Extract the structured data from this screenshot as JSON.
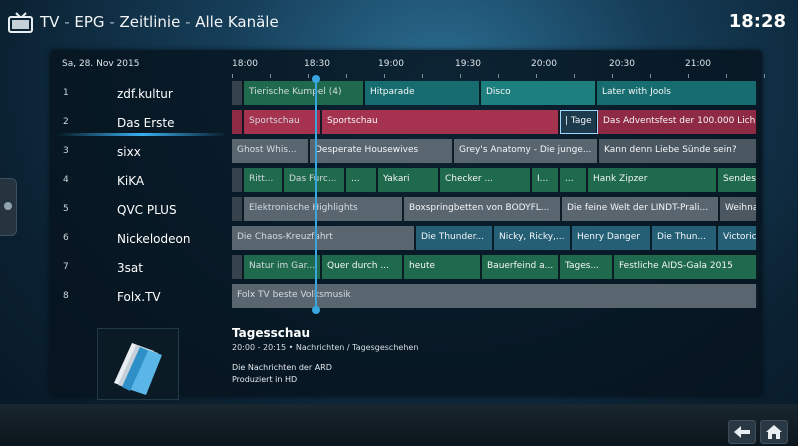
{
  "header": {
    "path": [
      "TV",
      "EPG",
      "Zeitlinie",
      "Alle Kanäle"
    ],
    "separator": " - ",
    "clock": "18:28"
  },
  "grid": {
    "date": "Sa, 28. Nov 2015",
    "times": [
      "18:00",
      "18:30",
      "19:00",
      "19:30",
      "20:00",
      "20:30",
      "21:00"
    ],
    "channels": [
      {
        "num": "1",
        "name": "zdf.kultur"
      },
      {
        "num": "2",
        "name": "Das Erste"
      },
      {
        "num": "3",
        "name": "sixx"
      },
      {
        "num": "4",
        "name": "KiKA"
      },
      {
        "num": "5",
        "name": "QVC PLUS"
      },
      {
        "num": "6",
        "name": "Nickelodeon"
      },
      {
        "num": "7",
        "name": "3sat"
      },
      {
        "num": "8",
        "name": "Folx.TV"
      }
    ],
    "rows": [
      [
        "Tierische Kumpel (4)",
        "Hitparade",
        "Disco",
        "Later with Jools"
      ],
      [
        "Sportschau",
        "Sportschau",
        "| Tage",
        "Das Adventsfest der 100.000 Lich"
      ],
      [
        "Ghost Whis...",
        "Desperate Housewives",
        "Grey's Anatomy - Die junge...",
        "Kann denn Liebe Sünde sein?"
      ],
      [
        "Ritt...",
        "Das Furc...",
        "...",
        "Yakari",
        "Checker ...",
        "I...",
        "...",
        "Hank Zipzer",
        "Sendes"
      ],
      [
        "Elektronische Highlights",
        "Boxspringbetten von BODYFL...",
        "Die feine Welt der LINDT-Prali...",
        "Weihna"
      ],
      [
        "Die Chaos-Kreuzfahrt",
        "Die Thunder...",
        "Nicky, Ricky,...",
        "Henry Danger",
        "Die Thun...",
        "Victoric"
      ],
      [
        "Natur im Gar...",
        "Quer durch ...",
        "heute",
        "Bauerfeind a...",
        "Tages...",
        "Festliche AIDS-Gala 2015"
      ],
      [
        "Folx TV beste Volksmusik"
      ]
    ]
  },
  "details": {
    "title": "Tagesschau",
    "meta": "20:00 - 20:15 • Nachrichten / Tagesgeschehen",
    "desc_line1": "Die Nachrichten der ARD",
    "desc_line2": "Produziert in HD"
  },
  "icons": [
    "tv-icon",
    "back-arrow-icon",
    "home-icon",
    "document-icon"
  ],
  "colors": {
    "accent": "#3aa6e0",
    "selected_program": "#a5324e"
  }
}
